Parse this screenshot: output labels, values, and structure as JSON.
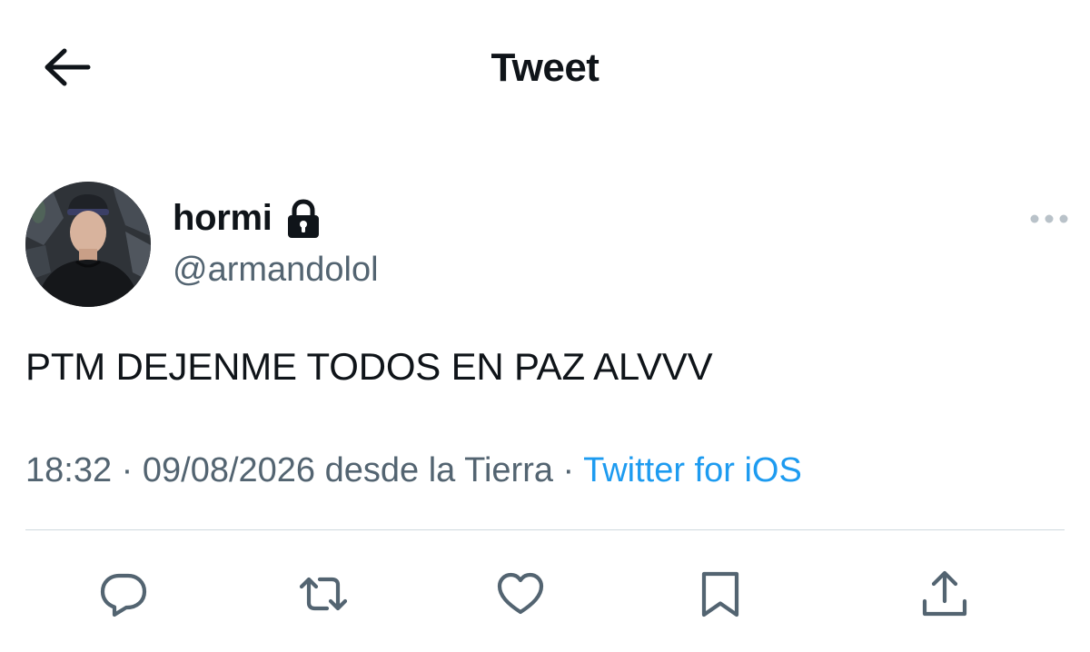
{
  "header": {
    "title": "Tweet",
    "back_icon": "arrow-left-icon"
  },
  "author": {
    "display_name": "hormi",
    "protected_icon": "lock-icon",
    "handle": "@armandolol",
    "avatar": "profile-photo"
  },
  "tweet": {
    "text": "PTM DEJENME TODOS EN PAZ ALVVV",
    "time": "18:32",
    "separator": " · ",
    "date_location": "09/08/2026 desde la Tierra",
    "source": "Twitter for iOS"
  },
  "actions": [
    {
      "name": "reply",
      "icon": "reply-icon"
    },
    {
      "name": "retweet",
      "icon": "retweet-icon"
    },
    {
      "name": "like",
      "icon": "heart-icon"
    },
    {
      "name": "bookmark",
      "icon": "bookmark-icon"
    },
    {
      "name": "share",
      "icon": "share-icon"
    }
  ],
  "colors": {
    "text_primary": "#0f1419",
    "text_secondary": "#536471",
    "link": "#1d9bf0",
    "divider": "#cfd9de"
  }
}
